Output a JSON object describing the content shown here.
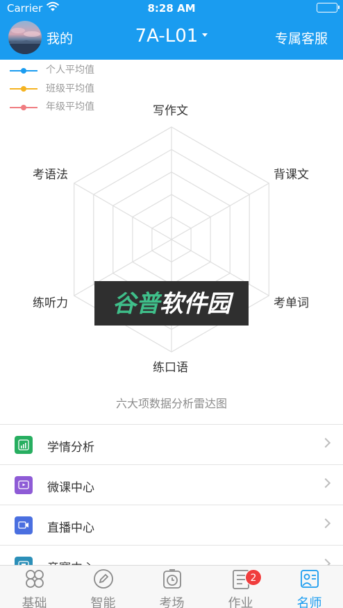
{
  "status_bar": {
    "carrier": "Carrier",
    "time": "8:28 AM"
  },
  "nav": {
    "mine": "我的",
    "class_name": "7A-L01",
    "service": "专属客服"
  },
  "legend": [
    {
      "label": "个人平均值",
      "color": "#1a9cf0"
    },
    {
      "label": "班级平均值",
      "color": "#f5b320"
    },
    {
      "label": "年级平均值",
      "color": "#f07c80"
    }
  ],
  "radar": {
    "axes": [
      "写作文",
      "背课文",
      "考单词",
      "练口语",
      "练听力",
      "考语法"
    ],
    "levels": 5,
    "caption": "六大项数据分析雷达图"
  },
  "watermark": "谷普软件园",
  "menu": [
    {
      "label": "学情分析",
      "icon": "chart-icon",
      "color": "#27ae60"
    },
    {
      "label": "微课中心",
      "icon": "video-icon",
      "color": "#8e5bd6"
    },
    {
      "label": "直播中心",
      "icon": "live-icon",
      "color": "#4a6fe0"
    },
    {
      "label": "竞赛中心",
      "icon": "trophy-icon",
      "color": "#2b8fb8"
    }
  ],
  "tabs": [
    {
      "label": "基础",
      "icon": "grid-icon",
      "active": false
    },
    {
      "label": "智能",
      "icon": "pen-icon",
      "active": false
    },
    {
      "label": "考场",
      "icon": "clock-icon",
      "active": false
    },
    {
      "label": "作业",
      "icon": "homework-icon",
      "active": false,
      "badge": "2"
    },
    {
      "label": "名师",
      "icon": "teacher-icon",
      "active": true
    }
  ],
  "colors": {
    "accent": "#1a9cf0",
    "badge": "#f03d3d"
  }
}
